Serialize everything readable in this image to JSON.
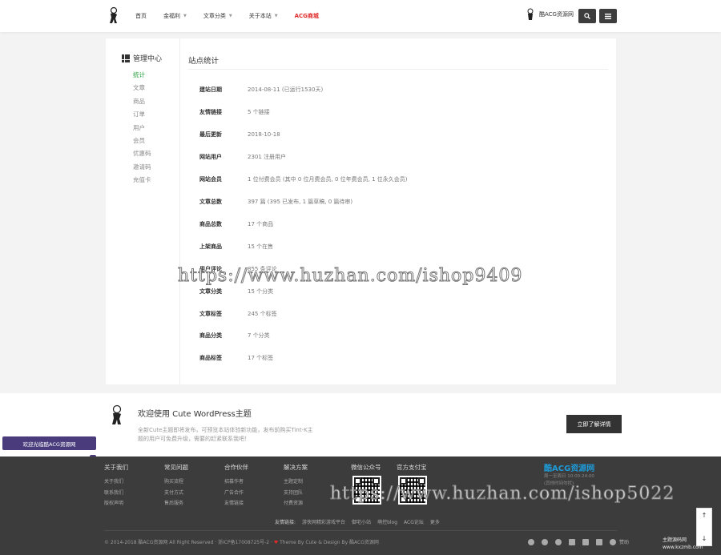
{
  "header": {
    "nav": [
      {
        "label": "首页",
        "has_caret": false
      },
      {
        "label": "金福利",
        "has_caret": true
      },
      {
        "label": "文章分类",
        "has_caret": true
      },
      {
        "label": "关于本站",
        "has_caret": true
      },
      {
        "label": "ACG商城",
        "has_caret": false,
        "highlight": true
      }
    ],
    "user_name": "酷ACG资源网"
  },
  "sidebar": {
    "title": "管理中心",
    "items": [
      {
        "label": "统计",
        "active": true
      },
      {
        "label": "文章"
      },
      {
        "label": "商品"
      },
      {
        "label": "订单"
      },
      {
        "label": "用户"
      },
      {
        "label": "会员"
      },
      {
        "label": "优惠码"
      },
      {
        "label": "邀请码"
      },
      {
        "label": "充值卡"
      }
    ]
  },
  "content": {
    "title": "站点统计",
    "stats": [
      {
        "label": "建站日期",
        "value": "2014-08-11 (已运行1530天)"
      },
      {
        "label": "友情链接",
        "value": "5 个链接"
      },
      {
        "label": "最后更新",
        "value": "2018-10-18"
      },
      {
        "label": "网站用户",
        "value": "2301 注册用户"
      },
      {
        "label": "网站会员",
        "value": "1 位付费会员 (其中 0 位月费会员, 0 位年费会员, 1 位永久会员)"
      },
      {
        "label": "文章总数",
        "value": "397 篇 (395 已发布, 1 篇草稿, 0 篇待审)"
      },
      {
        "label": "商品总数",
        "value": "17 个商品"
      },
      {
        "label": "上架商品",
        "value": "15 个在售"
      },
      {
        "label": "用户评论",
        "value": "855 条评论"
      },
      {
        "label": "文章分类",
        "value": "15 个分类"
      },
      {
        "label": "文章标签",
        "value": "245 个标签"
      },
      {
        "label": "商品分类",
        "value": "7 个分类"
      },
      {
        "label": "商品标签",
        "value": "17 个标签"
      }
    ]
  },
  "welcome": {
    "title": "欢迎使用 Cute WordPress主题",
    "desc": "全新Cute主题即将发布，可预览本站体验新功能，发布前购买Tint-K主题的用户可免费升级，需要的赶紧联系我吧！",
    "button": "立即了解详情",
    "float_tag": "酷ACG资源网",
    "float_tag_prefix": "欢迎光临",
    "float_dot": "0"
  },
  "footer": {
    "columns": [
      {
        "title": "关于我们",
        "links": [
          "关于我们",
          "联系我们",
          "版权声明"
        ]
      },
      {
        "title": "常见问题",
        "links": [
          "购买流程",
          "支付方式",
          "售后服务"
        ]
      },
      {
        "title": "合作伙伴",
        "links": [
          "招募作者",
          "广告合作",
          "友情链接"
        ]
      },
      {
        "title": "解决方案",
        "links": [
          "主题定制",
          "支持团队",
          "付费资源"
        ]
      }
    ],
    "qr_titles": [
      "微信公众号",
      "官方支付宝"
    ],
    "brand_name": "酷ACG资源网",
    "brand_lines": [
      "周一至周日 10:00-24:00",
      "(其他时间勿扰)"
    ],
    "links_label": "友情链接:",
    "links": [
      "游侠网精彩游戏平台",
      "御宅小站",
      "萌控blog",
      "ACG论坛",
      "更多"
    ],
    "copyright_pre": "© 2014-2018",
    "copyright_site": "酷ACG资源网 All Right Reserved · 浙ICP备17008725号-2 ·",
    "copyright_post": "Theme By Cute & Design By 酷ACG资源网",
    "social_label": "赞助"
  },
  "watermarks": [
    "https://www.huzhan.com/ishop9409",
    "https://www.huzhan.com/ishop5022"
  ],
  "corner_mark": [
    "主题源码网",
    "www.kxzmb.com"
  ]
}
